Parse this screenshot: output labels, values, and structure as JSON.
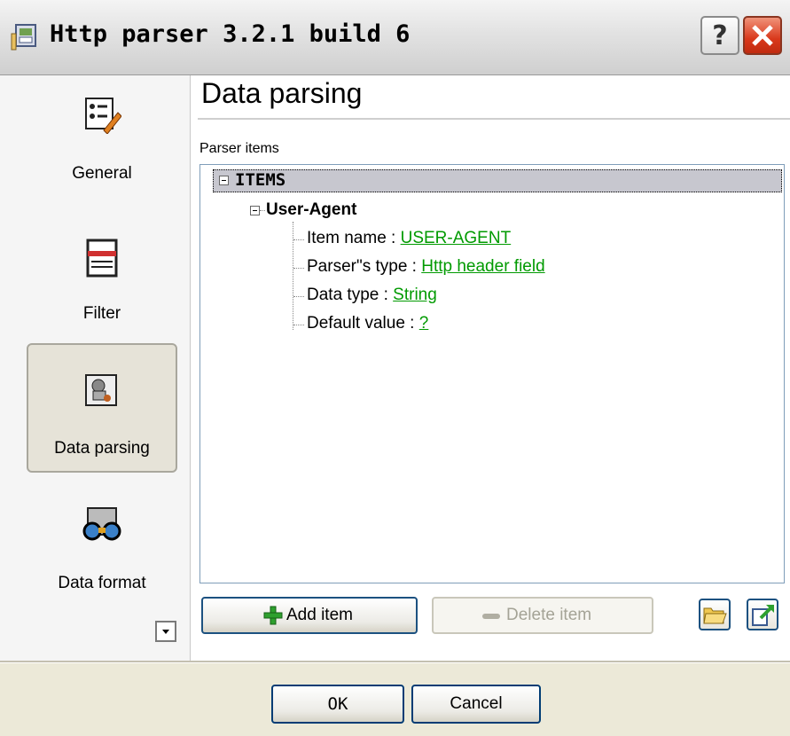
{
  "window": {
    "title": "Http parser 3.2.1 build 6",
    "help_label": "?",
    "close_label": "×"
  },
  "sidebar": {
    "items": [
      {
        "label": "General",
        "icon": "general-icon",
        "active": false
      },
      {
        "label": "Filter",
        "icon": "filter-icon",
        "active": false
      },
      {
        "label": "Data parsing",
        "icon": "data-parsing-icon",
        "active": true
      },
      {
        "label": "Data format",
        "icon": "data-format-icon",
        "active": false
      }
    ]
  },
  "main": {
    "title": "Data parsing",
    "section_label": "Parser items",
    "tree": {
      "root": "ITEMS",
      "child": "User-Agent",
      "props": [
        {
          "label": "Item name : ",
          "value": "USER-AGENT"
        },
        {
          "label": "Parser\"s type : ",
          "value": "Http header field"
        },
        {
          "label": "Data type : ",
          "value": "String"
        },
        {
          "label": "Default value : ",
          "value": "?"
        }
      ]
    },
    "add_label": "Add item",
    "delete_label": "Delete item"
  },
  "footer": {
    "ok_label": "OK",
    "cancel_label": "Cancel"
  },
  "colors": {
    "link": "#009a00",
    "active_nav": "#e6e3d8",
    "button_border": "#1c5180"
  }
}
